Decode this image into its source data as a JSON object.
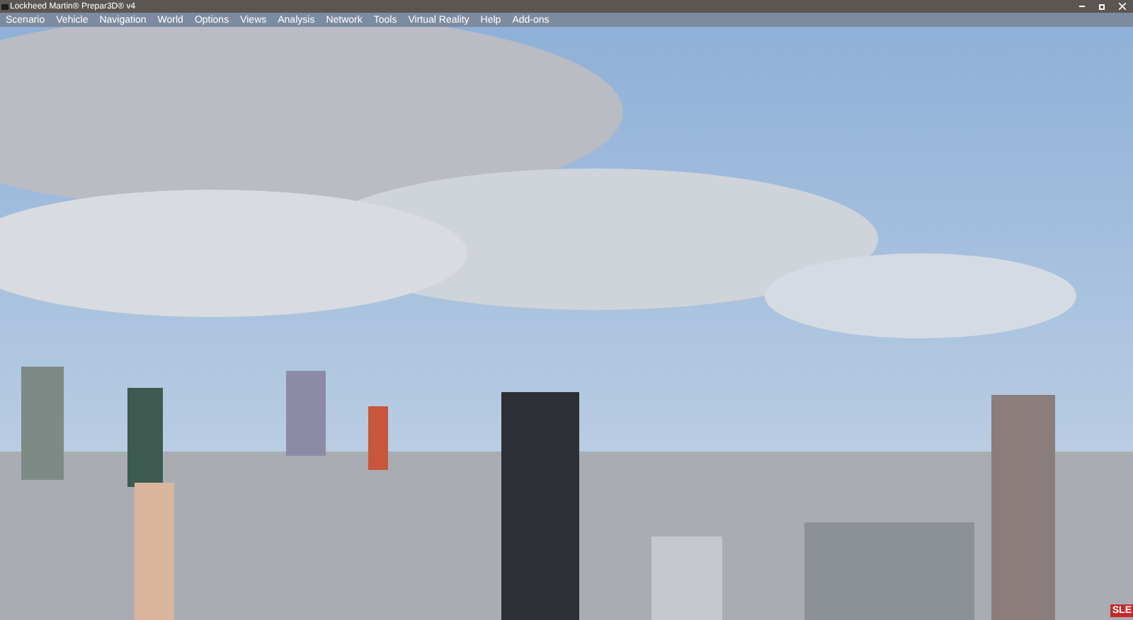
{
  "window": {
    "title": "Lockheed Martin® Prepar3D® v4"
  },
  "menu": [
    "Scenario",
    "Vehicle",
    "Navigation",
    "World",
    "Options",
    "Views",
    "Analysis",
    "Network",
    "Tools",
    "Virtual Reality",
    "Help",
    "Add-ons"
  ],
  "view": {
    "kind": "picture",
    "badge": "SLE"
  }
}
